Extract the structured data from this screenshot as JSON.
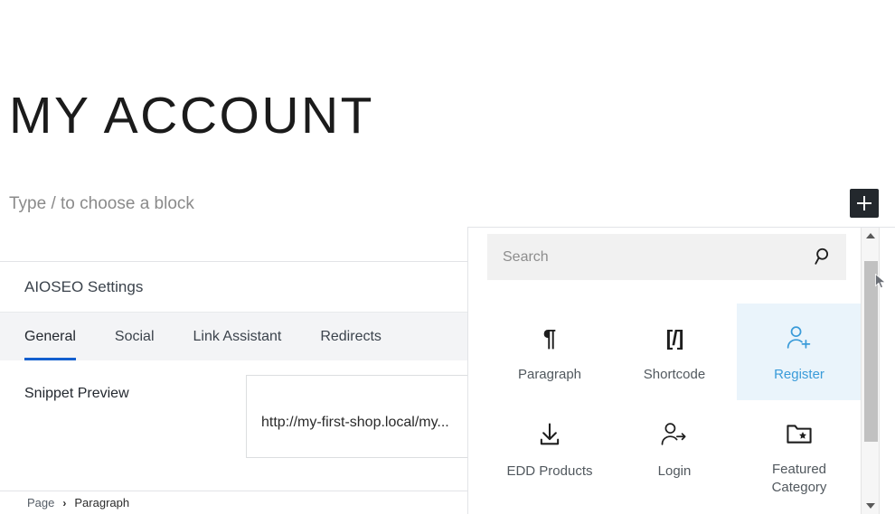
{
  "editor": {
    "page_title": "MY ACCOUNT",
    "block_placeholder": "Type / to choose a block",
    "inserter_toggle": {
      "icon": "plus-icon",
      "label": "Toggle block inserter"
    }
  },
  "aioseo": {
    "header_title": "AIOSEO Settings",
    "tabs": [
      {
        "label": "General",
        "active": true
      },
      {
        "label": "Social",
        "active": false
      },
      {
        "label": "Link Assistant",
        "active": false
      },
      {
        "label": "Redirects",
        "active": false
      }
    ],
    "snippet_preview_label": "Snippet Preview",
    "snippet_url": "http://my-first-shop.local/my...",
    "active_tab_color": "#135fce"
  },
  "breadcrumb": {
    "items": [
      {
        "label": "Page"
      },
      {
        "label": "Paragraph"
      }
    ],
    "separator": "›"
  },
  "inserter": {
    "search": {
      "placeholder": "Search",
      "value": "",
      "icon": "search-icon"
    },
    "blocks": [
      {
        "label": "Paragraph",
        "icon": "pilcrow-icon",
        "glyph": "¶",
        "selected": false
      },
      {
        "label": "Shortcode",
        "icon": "shortcode-icon",
        "glyph": "[/]",
        "selected": false
      },
      {
        "label": "Register",
        "icon": "user-add-icon",
        "glyph": "",
        "selected": true
      },
      {
        "label": "EDD Products",
        "icon": "download-icon",
        "glyph": "",
        "selected": false
      },
      {
        "label": "Login",
        "icon": "user-arrow-icon",
        "glyph": "",
        "selected": false
      },
      {
        "label": "Featured Category",
        "icon": "folder-star-icon",
        "glyph": "",
        "selected": false
      }
    ],
    "selected_color": "#3a9bd9",
    "selected_background": "#eaf4fb"
  },
  "scrollbar": {
    "up_arrow": "scroll-up-arrow",
    "down_arrow": "scroll-down-arrow",
    "thumb": "scroll-thumb"
  }
}
